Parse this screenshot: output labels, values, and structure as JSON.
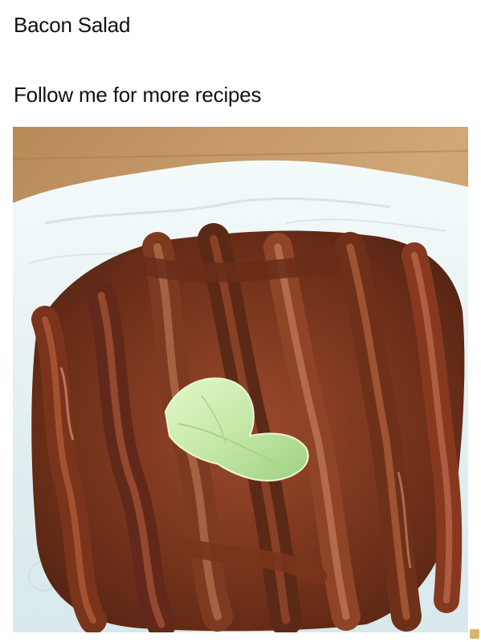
{
  "post": {
    "title": "Bacon Salad",
    "caption": "Follow me for more recipes"
  },
  "photo": {
    "subject_icon": "bacon-plate-photo"
  },
  "colors": {
    "background": "#ffffff",
    "text": "#111111",
    "table_wood": "#c9a06c",
    "paper_towel": "#e9f2f3",
    "bacon_dark": "#5b2a17",
    "bacon_mid": "#8f4327",
    "bacon_light": "#c27b5a",
    "lettuce": "#bfe4a4"
  }
}
